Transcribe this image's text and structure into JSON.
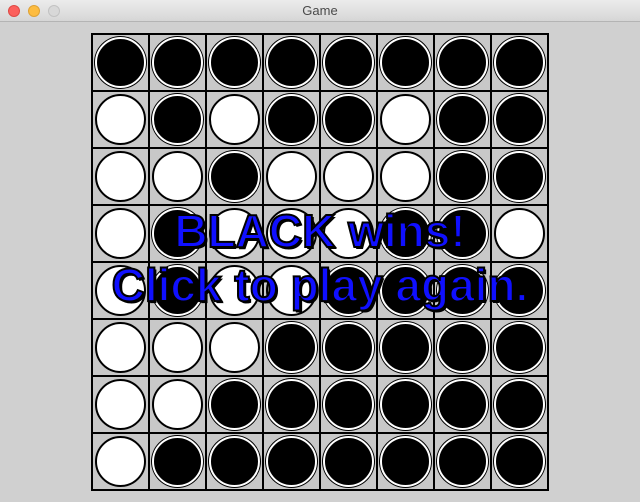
{
  "window": {
    "title": "Game"
  },
  "board": {
    "rows": [
      [
        "black",
        "black",
        "black",
        "black",
        "black",
        "black",
        "black",
        "black"
      ],
      [
        "white",
        "black",
        "white",
        "black",
        "black",
        "white",
        "black",
        "black"
      ],
      [
        "white",
        "white",
        "black",
        "white",
        "white",
        "white",
        "black",
        "black"
      ],
      [
        "white",
        "black",
        "white",
        "white",
        "white",
        "black",
        "black",
        "white"
      ],
      [
        "white",
        "black",
        "white",
        "white",
        "black",
        "black",
        "black",
        "black"
      ],
      [
        "white",
        "white",
        "white",
        "black",
        "black",
        "black",
        "black",
        "black"
      ],
      [
        "white",
        "white",
        "black",
        "black",
        "black",
        "black",
        "black",
        "black"
      ],
      [
        "white",
        "black",
        "black",
        "black",
        "black",
        "black",
        "black",
        "black"
      ]
    ]
  },
  "message": {
    "line1": "BLACK wins!",
    "line2": "Click to play again."
  },
  "colors": {
    "message": "#1010ff",
    "board_bg": "#c8c8c8"
  }
}
